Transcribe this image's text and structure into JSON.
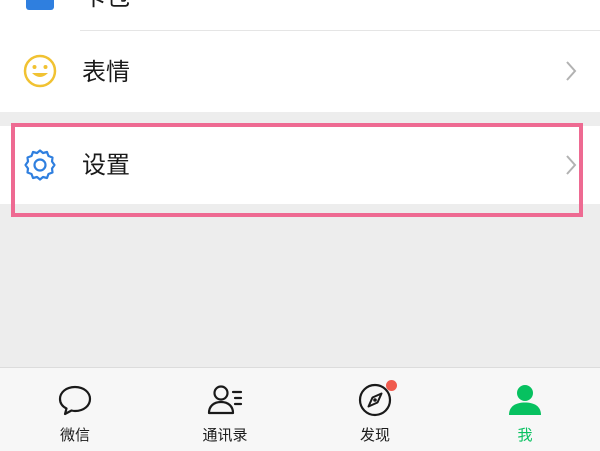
{
  "list": {
    "partial_item": {
      "icon": "folder-icon",
      "label": "卡包"
    },
    "emoji_item": {
      "icon": "smiley-icon",
      "label": "表情",
      "chevron": "chevron-right-icon"
    },
    "settings_item": {
      "icon": "gear-icon",
      "label": "设置",
      "chevron": "chevron-right-icon"
    }
  },
  "tabbar": {
    "tabs": [
      {
        "id": "chats",
        "icon": "chat-bubble-icon",
        "label": "微信"
      },
      {
        "id": "contacts",
        "icon": "contacts-icon",
        "label": "通讯录"
      },
      {
        "id": "discover",
        "icon": "compass-icon",
        "label": "发现",
        "badge": "dot"
      },
      {
        "id": "me",
        "icon": "person-icon",
        "label": "我",
        "active": true
      }
    ]
  },
  "colors": {
    "accent_green": "#07c160",
    "highlight_border": "#ee6a92",
    "emoji_yellow": "#f1c232",
    "gear_blue": "#2f7fdf",
    "badge_red": "#f05b4e"
  }
}
